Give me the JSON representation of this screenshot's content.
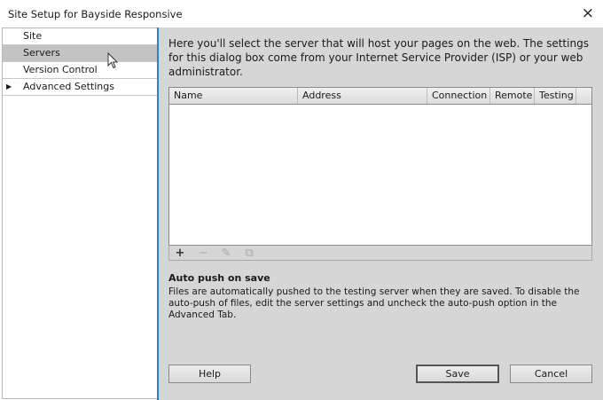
{
  "window": {
    "title": "Site Setup for Bayside Responsive",
    "close_icon": "×"
  },
  "sidebar": {
    "items": [
      {
        "label": "Site"
      },
      {
        "label": "Servers",
        "selected": true
      },
      {
        "label": "Version Control"
      },
      {
        "label": "Advanced Settings",
        "expander": "▶"
      }
    ]
  },
  "main": {
    "intro": "Here you'll select the server that will host your pages on the web. The settings for this dialog box come from your Internet Service Provider (ISP) or your web administrator.",
    "table": {
      "columns": [
        "Name",
        "Address",
        "Connection",
        "Remote",
        "Testing"
      ],
      "rows": []
    },
    "toolbar": {
      "add": "+",
      "remove": "−",
      "edit": "✎",
      "duplicate": "⧉"
    },
    "auto_push": {
      "heading": "Auto push on save",
      "description": "Files are automatically pushed to the testing server when they are saved. To disable the auto-push of files, edit the server settings and uncheck the auto-push option in the Advanced Tab."
    }
  },
  "buttons": {
    "help": "Help",
    "save": "Save",
    "cancel": "Cancel"
  }
}
